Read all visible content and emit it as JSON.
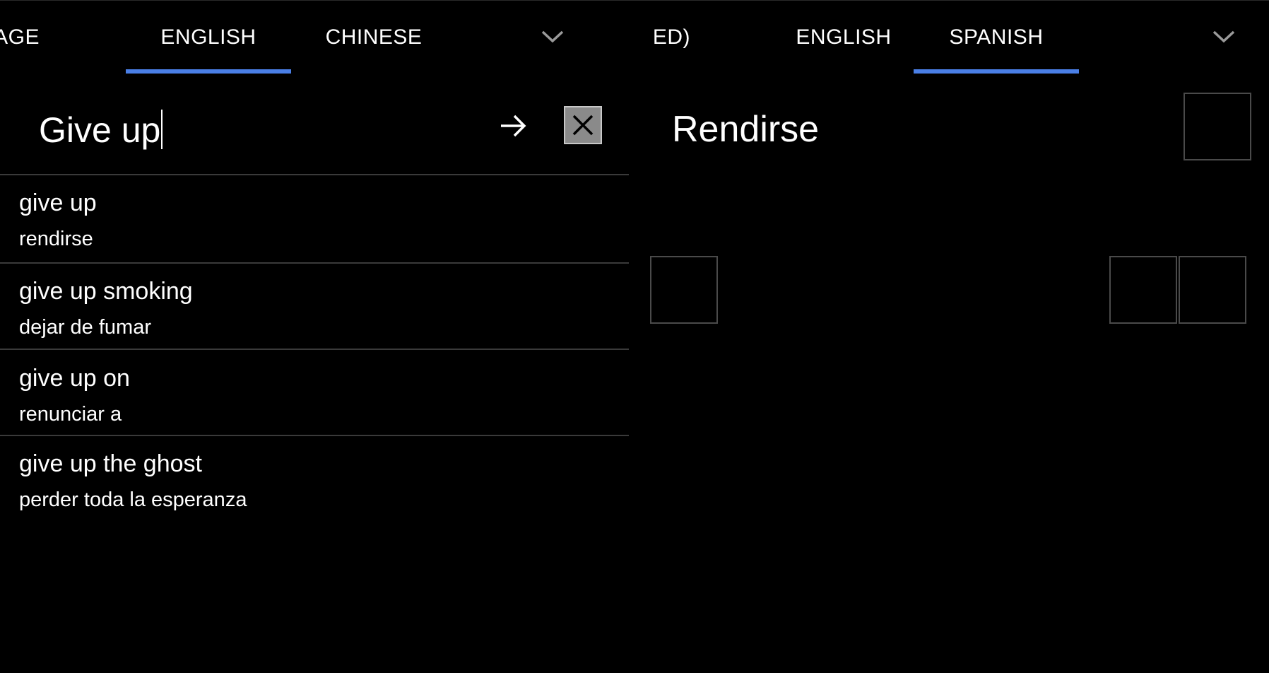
{
  "theme": {
    "accent": "#4a7fe6",
    "background": "#000000",
    "text": "#ffffff",
    "clear_button_bg": "#8a8a8a"
  },
  "source_tabs": {
    "items": [
      {
        "label": "UAGE",
        "active": false
      },
      {
        "label": "ENGLISH",
        "active": true
      },
      {
        "label": "CHINESE",
        "active": false
      }
    ],
    "dropdown_icon": "chevron-down-icon"
  },
  "target_tabs": {
    "items": [
      {
        "label": "PLIFIED)",
        "active": false
      },
      {
        "label": "ENGLISH",
        "active": false
      },
      {
        "label": "SPANISH",
        "active": true
      }
    ],
    "dropdown_icon": "chevron-down-icon"
  },
  "input": {
    "value": "Give up",
    "submit_icon": "arrow-right-icon",
    "clear_icon": "close-icon"
  },
  "suggestions": [
    {
      "phrase": "give up",
      "translation": "rendirse"
    },
    {
      "phrase": "give up smoking",
      "translation": "dejar de fumar"
    },
    {
      "phrase": "give up on",
      "translation": "renunciar a"
    },
    {
      "phrase": "give up the ghost",
      "translation": "perder toda la esperanza"
    }
  ],
  "result": {
    "text": "Rendirse"
  }
}
